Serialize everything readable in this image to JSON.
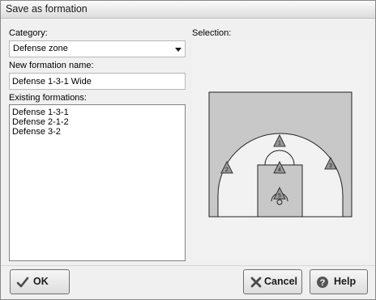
{
  "window": {
    "title": "Save as formation"
  },
  "category": {
    "label": "Category:",
    "value": "Defense zone"
  },
  "name_field": {
    "label": "New formation name:",
    "value": "Defense 1-3-1 Wide"
  },
  "existing": {
    "label": "Existing formations:",
    "items": [
      "Defense 1-3-1",
      "Defense 2-1-2",
      "Defense 3-2"
    ]
  },
  "selection": {
    "label": "Selection:",
    "players": [
      {
        "number": "1"
      },
      {
        "number": "2"
      },
      {
        "number": "3"
      },
      {
        "number": "4"
      },
      {
        "number": "5"
      }
    ]
  },
  "buttons": {
    "ok": "OK",
    "cancel": "Cancel",
    "help": "Help"
  },
  "icons": {
    "ok": "checkmark-icon",
    "cancel": "close-icon",
    "help": "help-icon"
  },
  "colors": {
    "court_outer": "#c8c8c8",
    "court_inner": "#f2f2f2",
    "player_fill": "#9a9a9a"
  }
}
